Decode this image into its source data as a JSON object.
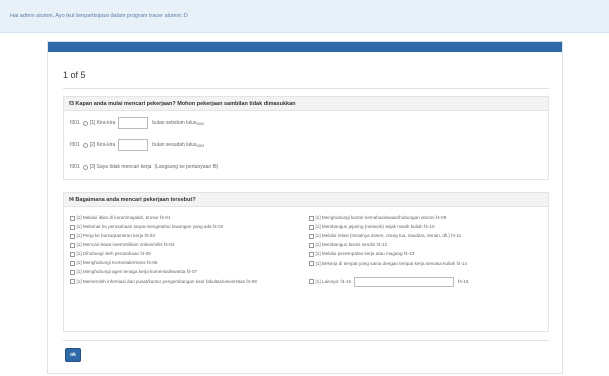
{
  "alert": {
    "text": "Hai admin alumni, Ayo ikut berpartisipasi dalam program tracer alumni :D"
  },
  "page": {
    "title": "1 of 5"
  },
  "f3": {
    "title": "f3 Kapan anda mulai mencari pekerjaan? Mohon pekerjaan sambilan tidak dimasukkan",
    "options": [
      {
        "code": "f301",
        "label": "[1] Kira-kira",
        "suffix": "bulan sebelum lulus",
        "sub": "f302"
      },
      {
        "code": "f301",
        "label": "[2] Kira-kira",
        "suffix": "bulan sesudah lulus",
        "sub": "f303"
      },
      {
        "code": "f301",
        "label": "[3] Saya tidak mencari kerja",
        "suffix": "(Langsung ke pertanyaan f8)",
        "sub": ""
      }
    ]
  },
  "f4": {
    "title": "f4 Bagaimana anda mencari pekerjaan tersebut?",
    "left": [
      {
        "label": "[1] Melalui iklan di koran/majalah, brosur",
        "code": "f4-01"
      },
      {
        "label": "[1] Melamar ke perusahaan tanpa mengetahui lowongan yang ada",
        "code": "f4-02"
      },
      {
        "label": "[1] Pergi ke bursa/pameran kerja",
        "code": "f4-03"
      },
      {
        "label": "[1] Mencari lewat internet/iklan online/milis",
        "code": "f4-04"
      },
      {
        "label": "[1] Dihubungi oleh perusahaan",
        "code": "f4-05"
      },
      {
        "label": "[1] Menghubungi Kemenakertrans",
        "code": "f4-06"
      },
      {
        "label": "[1] Menghubungi agen tenaga kerja komersial/swasta",
        "code": "f4-07"
      },
      {
        "label": "[1] Memeroleh informasi dari pusat/kantor pengembangan karir fakultas/universitas",
        "code": "f4-08"
      }
    ],
    "right": [
      {
        "label": "[1] Menghubungi kantor kemahasiswaan/hubungan alumni",
        "code": "f4-09"
      },
      {
        "label": "[1] Membangun jejaring (network) sejak masih kuliah",
        "code": "f4-10"
      },
      {
        "label": "[1] Melalui relasi (misalnya dosen, orang tua, saudara, teman, dll.)",
        "code": "f4-11"
      },
      {
        "label": "[1] Membangun bisnis sendiri",
        "code": "f4-12"
      },
      {
        "label": "[1] Melalui penempatan kerja atau magang",
        "code": "f4-13"
      },
      {
        "label": "[1] Bekerja di tempat yang sama dengan tempat kerja semasa kuliah",
        "code": "f4-14"
      }
    ],
    "lainnya": {
      "label": "[1] Lainnya:",
      "code": "f4-15",
      "code2": "f4-16"
    }
  },
  "submit": {
    "label": "ok"
  },
  "colors": {
    "accent": "#2f69a8",
    "alert_bg": "#e8f0f8"
  }
}
